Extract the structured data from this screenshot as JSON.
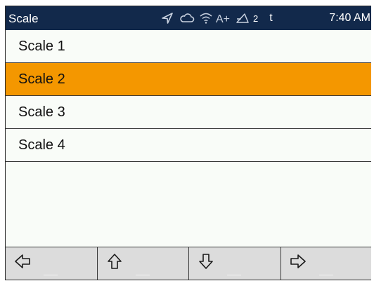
{
  "statusbar": {
    "title": "Scale",
    "icons": [
      "send-icon",
      "cloud-icon",
      "wifi-icon",
      "a-plus-icon",
      "signal-triangle-icon"
    ],
    "signal_count": "2",
    "t_indicator": "t",
    "time": "7:40 AM"
  },
  "list": {
    "items": [
      {
        "label": "Scale 1",
        "selected": false
      },
      {
        "label": "Scale 2",
        "selected": true
      },
      {
        "label": "Scale 3",
        "selected": false
      },
      {
        "label": "Scale 4",
        "selected": false
      }
    ]
  },
  "softkeys": [
    "arrow-left-icon",
    "arrow-up-icon",
    "arrow-down-icon",
    "arrow-right-icon"
  ],
  "colors": {
    "statusbar_bg": "#12294b",
    "selected_bg": "#f49700",
    "list_bg": "#f9fcf8",
    "softkey_bg": "#dcdcdc"
  }
}
